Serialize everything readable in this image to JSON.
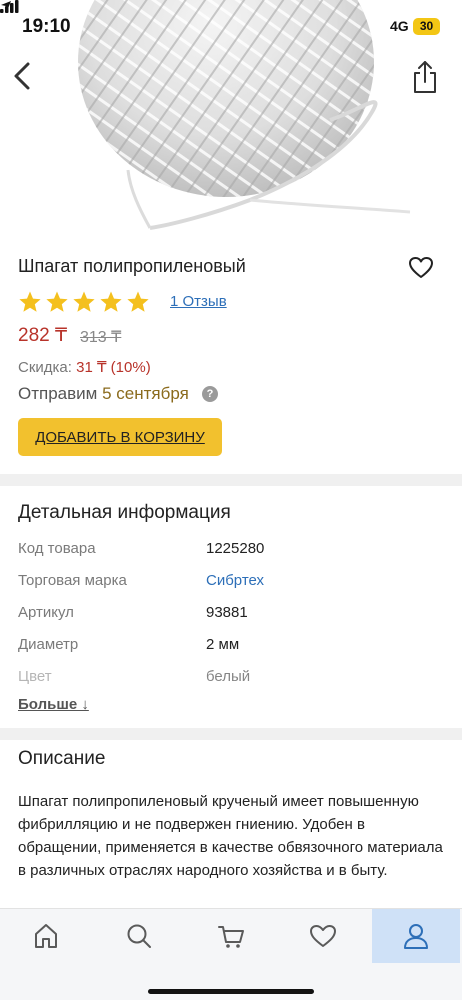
{
  "status_bar": {
    "time": "19:10",
    "network": "4G",
    "battery": "30"
  },
  "icons": {
    "back": "chevron-left-icon",
    "share": "share-icon",
    "favorite": "heart-icon",
    "help": "question-icon"
  },
  "product": {
    "title": "Шпагат полипропиленовый",
    "rating": 5,
    "reviews_label": "1 Отзыв",
    "price": "282 ₸",
    "old_price": "313 ₸",
    "discount_label": "Скидка:",
    "discount_value": "31 ₸ (10%)",
    "ship_label": "Отправим",
    "ship_date": "5 сентября",
    "help_glyph": "?",
    "add_to_cart_label": "ДОБАВИТЬ В КОРЗИНУ"
  },
  "details": {
    "heading": "Детальная информация",
    "rows": [
      {
        "key": "Код товара",
        "value": "1225280"
      },
      {
        "key": "Торговая марка",
        "value": "Сибртех"
      },
      {
        "key": "Артикул",
        "value": "93881"
      },
      {
        "key": "Диаметр",
        "value": "2 мм"
      },
      {
        "key": "Цвет",
        "value": "белый"
      }
    ],
    "more_label": "Больше ↓"
  },
  "description": {
    "heading": "Описание",
    "text": "Шпагат полипропиленовый крученый имеет повышенную фибрилляцию и не подвержен гниению. Удобен в обращении, применяется в качестве обвязочного материала в различных отраслях народного хозяйства и в быту."
  },
  "bottom_nav": {
    "items": [
      "home-icon",
      "search-icon",
      "cart-icon",
      "favorites-icon",
      "profile-icon"
    ],
    "active": "profile-icon"
  },
  "colors": {
    "accent_yellow": "#f2c12e",
    "star": "#f4c01e",
    "price_red": "#b8332a",
    "link_blue": "#2d6fb8",
    "nav_active": "#cfe1f7"
  }
}
